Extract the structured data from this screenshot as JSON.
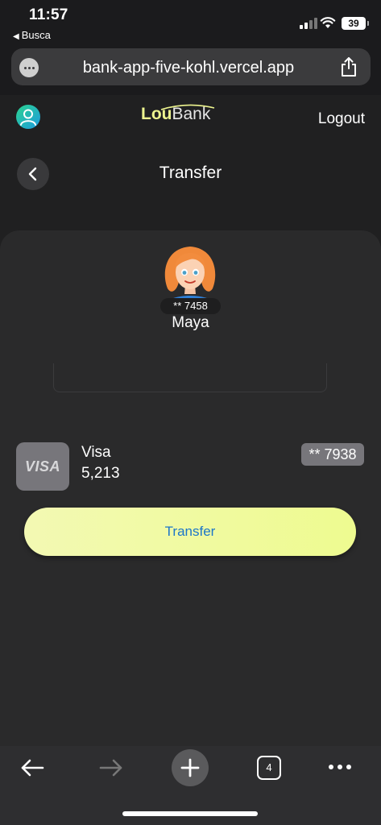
{
  "status_bar": {
    "time": "11:57",
    "back_app_label": "Busca",
    "battery": "39",
    "icons": [
      "signal-icon",
      "wifi-icon",
      "battery-icon"
    ]
  },
  "browser": {
    "url": "bank-app-five-kohl.vercel.app",
    "icons": [
      "more-options-icon",
      "share-icon"
    ]
  },
  "header": {
    "logo_part1": "Lou",
    "logo_part2": "Bank",
    "logout_label": "Logout",
    "profile_icon": "user-icon"
  },
  "page": {
    "title": "Transfer",
    "back_icon": "chevron-left-icon"
  },
  "recipient": {
    "account": "** 7458",
    "name": "Maya",
    "avatar": "woman-avatar"
  },
  "amount": {
    "value": "",
    "placeholder": ""
  },
  "source_card": {
    "brand": "VISA",
    "name": "Visa",
    "balance": "5,213",
    "number": "** 7938"
  },
  "transfer_button_label": "Transfer",
  "toolbar": {
    "tabs_count": "4",
    "icons": [
      "back-arrow-icon",
      "forward-arrow-icon",
      "plus-icon",
      "tabs-icon",
      "more-icon"
    ]
  },
  "colors": {
    "background": "#202021",
    "card": "#2a2a2b",
    "accent": "#eefb90",
    "button_text": "#1c76c9"
  }
}
